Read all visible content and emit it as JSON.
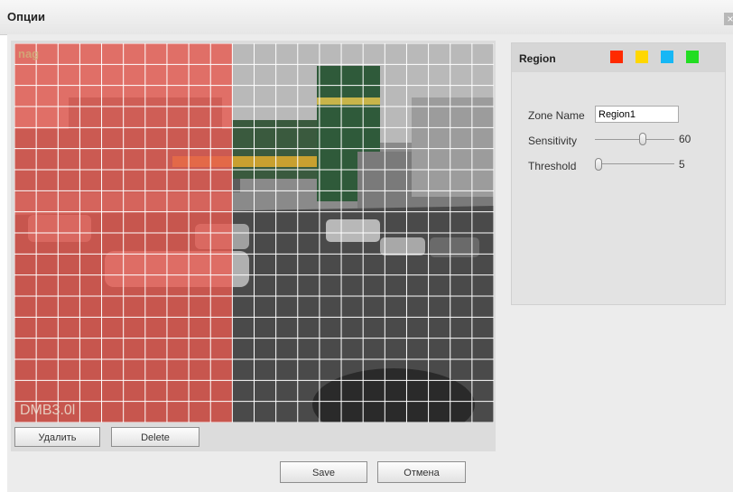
{
  "window": {
    "title": "Опции",
    "close_glyph": "×"
  },
  "video": {
    "osd_logo": "nag",
    "osd_label": "DMB3.0l",
    "grid": {
      "cols": 22,
      "rows": 18,
      "selected_cols": 10,
      "selected_color": "#ea5a50"
    }
  },
  "buttons": {
    "clear": "Удалить",
    "delete": "Delete",
    "save": "Save",
    "cancel": "Отмена"
  },
  "region": {
    "title": "Region",
    "swatches": [
      {
        "name": "red",
        "color": "#ff2a00"
      },
      {
        "name": "yellow",
        "color": "#ffd700"
      },
      {
        "name": "cyan",
        "color": "#16b7f5"
      },
      {
        "name": "green",
        "color": "#22dd22"
      }
    ],
    "zone_name_label": "Zone Name",
    "zone_name_value": "Region1",
    "sensitivity_label": "Sensitivity",
    "sensitivity_value": "60",
    "sensitivity_level": 0.6,
    "threshold_label": "Threshold",
    "threshold_value": "5",
    "threshold_level": 0.05
  }
}
